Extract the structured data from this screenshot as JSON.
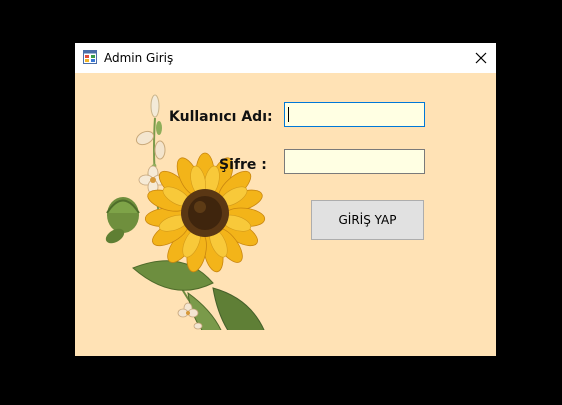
{
  "window": {
    "title": "Admin Giriş",
    "background_color": "#ffe2b5",
    "app_icon": "windows-form-icon",
    "close_icon": "close-icon"
  },
  "form": {
    "username_label": "Kullanıcı Adı:",
    "username_value": "",
    "password_label": "Şifre :",
    "password_value": "",
    "input_background": "#ffffe3",
    "focused_border": "#0078d7",
    "login_button_label": "GİRİŞ YAP"
  },
  "decoration": {
    "image": "sunflower-bouquet-illustration"
  }
}
